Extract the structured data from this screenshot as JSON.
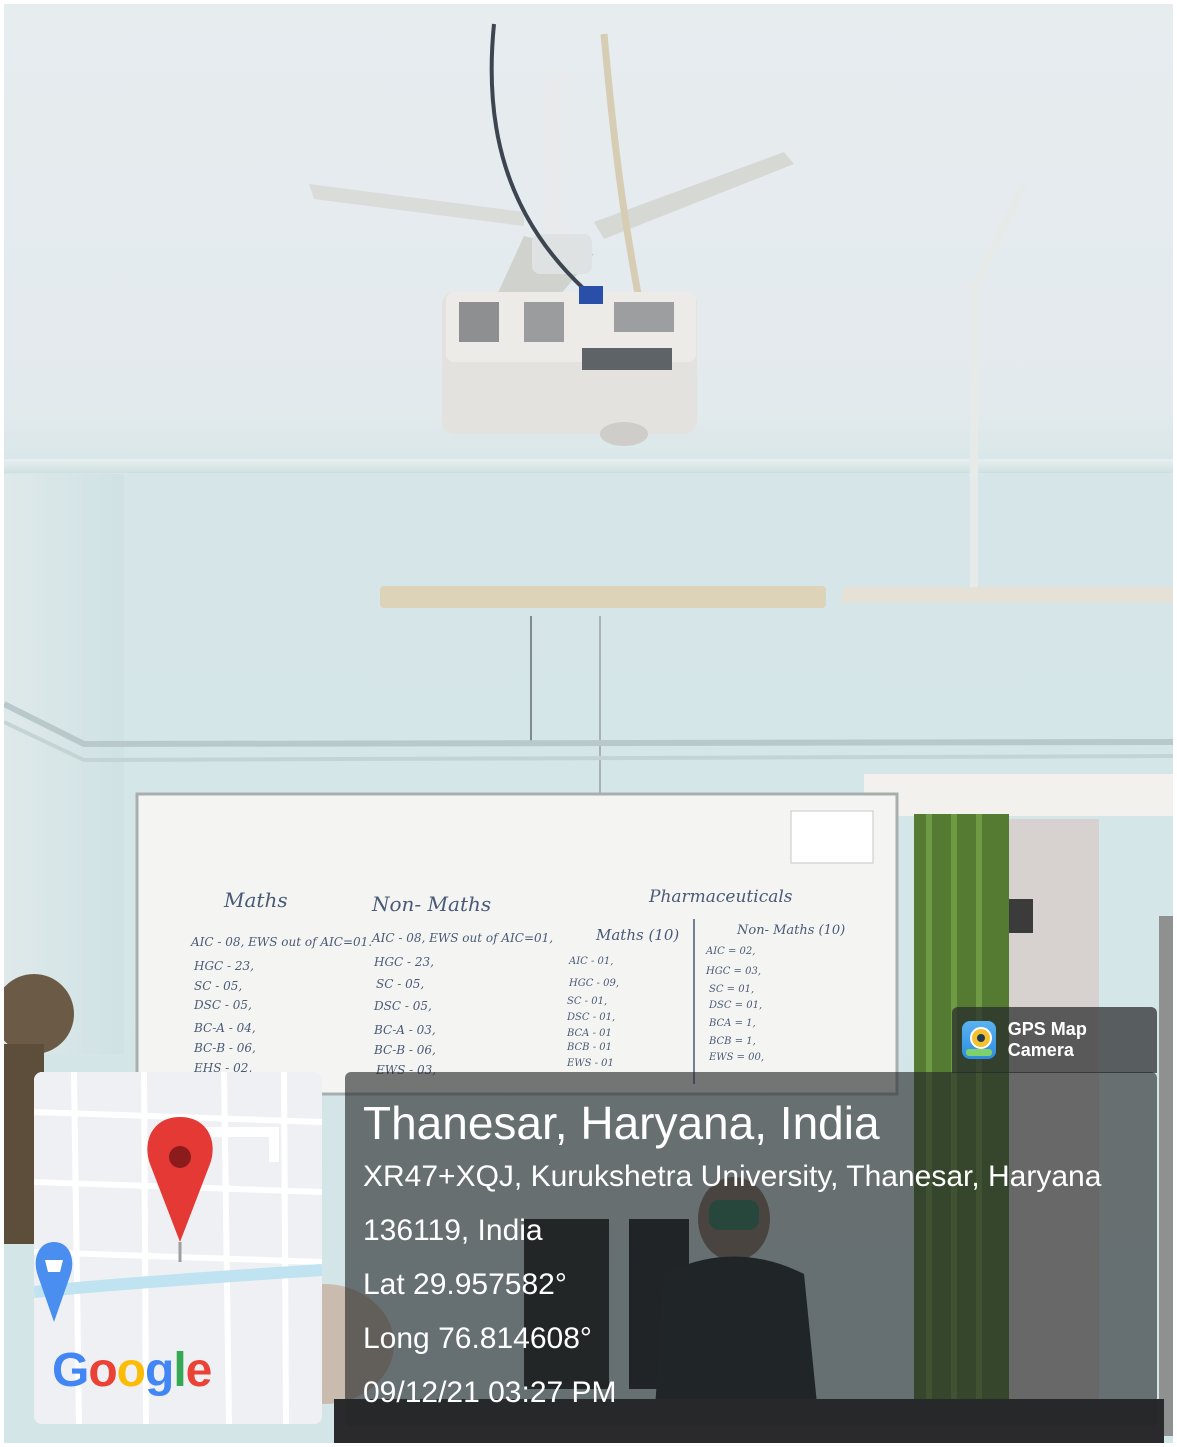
{
  "badge": {
    "icon": "gps-map-camera-icon",
    "label": "GPS Map Camera"
  },
  "map": {
    "pin_icon": "map-pin-icon",
    "cart_icon": "shopping-cart-icon",
    "logo_letters": [
      "G",
      "o",
      "o",
      "g",
      "l",
      "e"
    ]
  },
  "location": {
    "title": "Thanesar, Haryana, India",
    "address_line1": "XR47+XQJ, Kurukshetra University, Thanesar, Haryana",
    "address_line2": "136119, India",
    "latitude": "Lat 29.957582°",
    "longitude": "Long 76.814608°",
    "timestamp": "09/12/21 03:27 PM"
  },
  "whiteboard": {
    "headings": [
      "Maths",
      "Non- Maths",
      "Pharmaceuticals",
      "Maths (10)",
      "Non- Maths (10)"
    ],
    "col1": [
      "AIC - 08, EWS out of AIC=01.",
      "HGC - 23,",
      "SC - 05,",
      "DSC - 05,",
      "BC-A - 04,",
      "BC-B - 06,",
      "EHS - 02,"
    ],
    "col2": [
      "AIC - 08, EWS out of AIC=01,",
      "HGC - 23,",
      "SC - 05,",
      "DSC - 05,",
      "BC-A - 03,",
      "BC-B - 06,",
      "EWS - 03,"
    ],
    "col3": [
      "AIC - 01,",
      "HGC - 09,",
      "SC - 01,",
      "DSC - 01,",
      "BCA - 01",
      "BCB - 01",
      "EWS - 01"
    ],
    "col4": [
      "AIC = 02,",
      "HGC = 03,",
      "SC = 01,",
      "DSC = 01,",
      "BCA = 1,",
      "BCB = 1,",
      "EWS = 00,"
    ]
  },
  "colors": {
    "accent_pin": "#e53935",
    "panel": "#232628"
  }
}
